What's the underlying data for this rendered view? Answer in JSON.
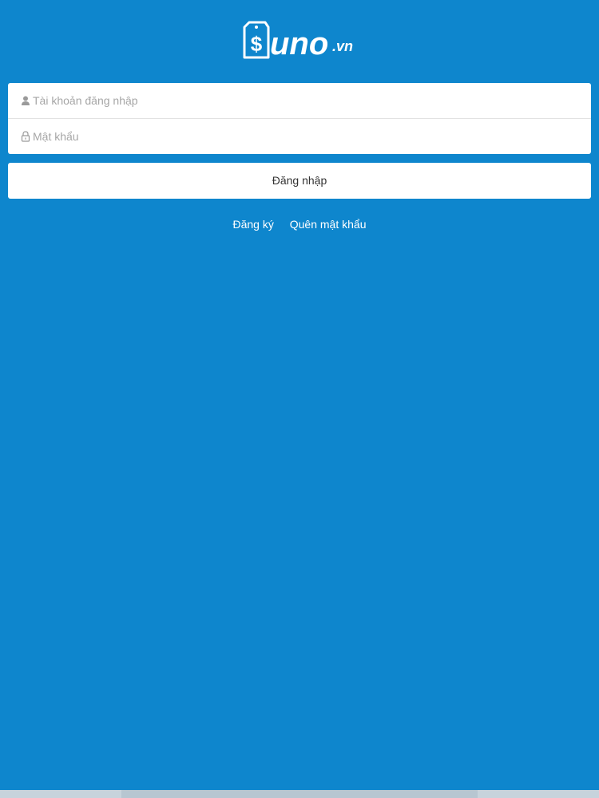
{
  "brand": {
    "logo_text": "$uno.vn",
    "bg_color": "#0e86cd"
  },
  "login_form": {
    "username_placeholder": "Tài khoản đăng nhập",
    "username_icon": "user-icon",
    "password_placeholder": "Mật khẩu",
    "password_icon": "lock-icon",
    "submit_label": "Đăng nhập"
  },
  "links": {
    "register": "Đăng ký",
    "forgot_password": "Quên mật khẩu"
  }
}
